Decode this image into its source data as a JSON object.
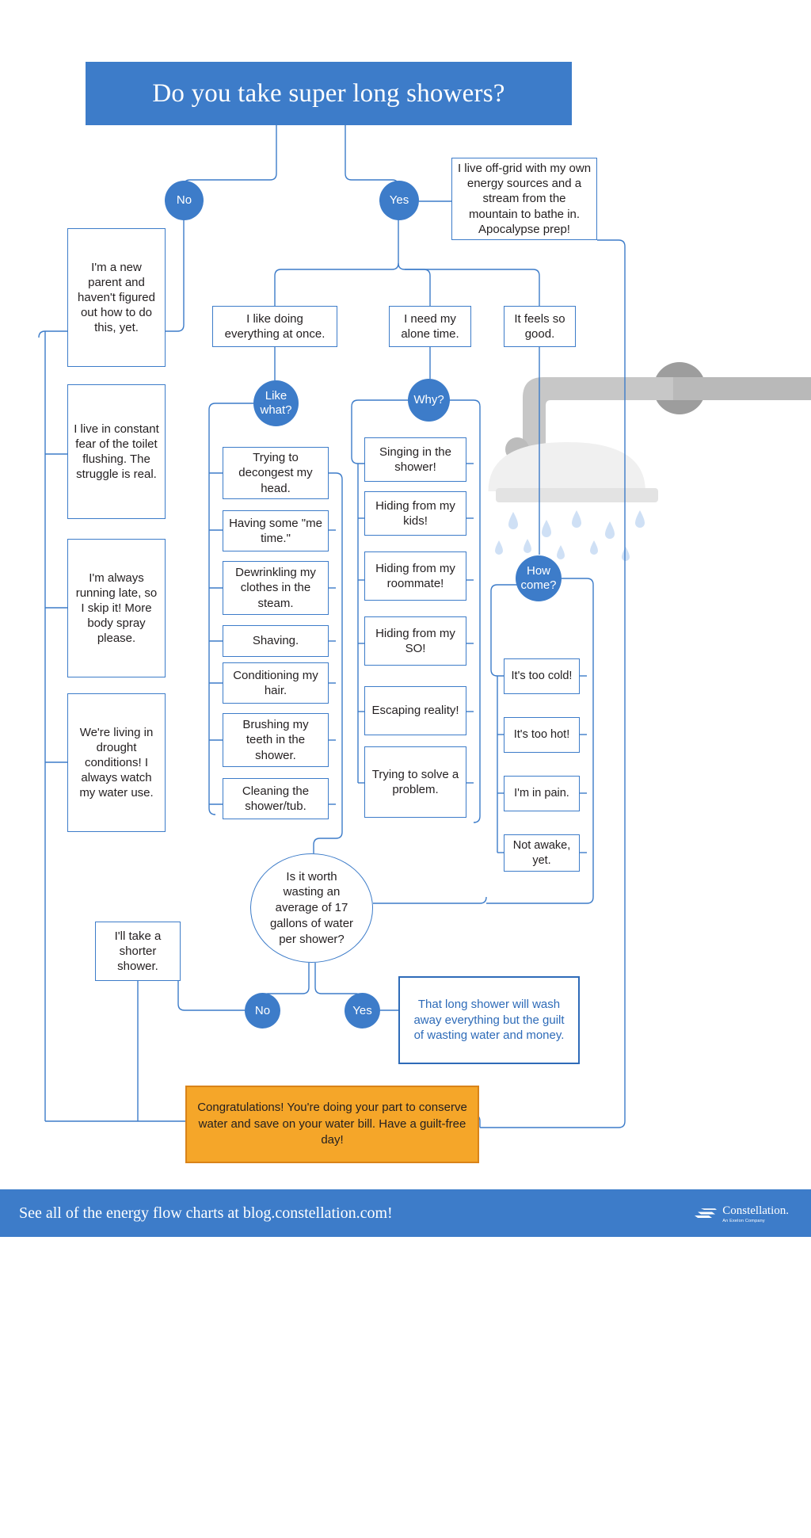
{
  "header": {
    "title": "Do you take super long showers?",
    "bg_color": "#3d7cc9"
  },
  "branch_labels": {
    "no": "No",
    "yes": "Yes"
  },
  "offgrid_box": "I live off-grid with my own energy sources and a stream from the mountain to bathe in. Apocalypse prep!",
  "no_branch": {
    "items": [
      "I'm a new parent and haven't figured out how to do this, yet.",
      "I live in constant fear of the toilet flushing. The struggle is real.",
      "I'm always running late, so I skip it! More body spray please.",
      "We're living in drought conditions! I always watch my water use."
    ]
  },
  "yes_branch": {
    "reasons": [
      "I like doing everything at once.",
      "I need my alone time.",
      "It feels so good."
    ]
  },
  "like_what": {
    "bubble": "Like what?",
    "items": [
      "Trying to decongest my head.",
      "Having some \"me time.\"",
      "Dewrinkling my clothes in the steam.",
      "Shaving.",
      "Conditioning my hair.",
      "Brushing my teeth in the shower.",
      "Cleaning the shower/tub."
    ]
  },
  "why": {
    "bubble": "Why?",
    "items": [
      "Singing in the shower!",
      "Hiding from my kids!",
      "Hiding from my roommate!",
      "Hiding from my SO!",
      "Escaping reality!",
      "Trying to solve a problem."
    ]
  },
  "how_come": {
    "bubble": "How come?",
    "items": [
      "It's too cold!",
      "It's too hot!",
      "I'm in pain.",
      "Not awake, yet."
    ]
  },
  "decision": {
    "question": "Is it worth wasting an average of 17 gallons of water per shower?",
    "no_label": "No",
    "yes_label": "Yes",
    "no_result": "I'll take a shorter shower.",
    "yes_result": "That long shower will wash away everything but the guilt of wasting water and money."
  },
  "congrats": "Congratulations! You're doing your part to conserve water and save on your water bill. Have a guilt-free day!",
  "footer": {
    "text": "See all of the energy flow charts at blog.constellation.com!",
    "logo_name": "Constellation.",
    "logo_sub": "An Exelon Company",
    "bg_color": "#3d7cc9"
  },
  "colors": {
    "brand_blue": "#3d7cc9",
    "line_blue": "#3d7cc9",
    "orange": "#f5a629",
    "water_drop": "#cfe0f5"
  }
}
